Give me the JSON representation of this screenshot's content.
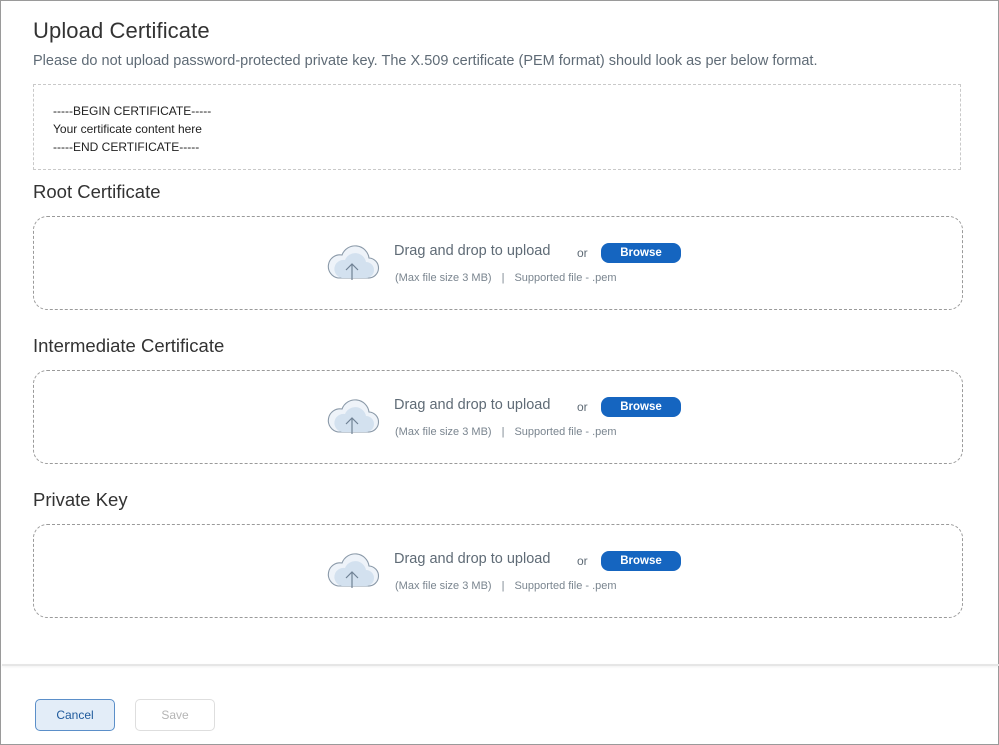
{
  "dialog": {
    "title": "Upload Certificate",
    "subtitle": "Please do not upload password-protected private key. The X.509 certificate (PEM format) should look as per below format."
  },
  "pem_example": {
    "line1": "-----BEGIN CERTIFICATE-----",
    "line2": "Your certificate content here",
    "line3": "-----END CERTIFICATE-----"
  },
  "sections": [
    {
      "label": "Root Certificate",
      "drop_text": "Drag and drop to upload",
      "or_text": "or",
      "browse_label": "Browse",
      "max_size": "(Max file size 3 MB)",
      "separator": "|",
      "supported": "Supported file -",
      "extension": ".pem"
    },
    {
      "label": "Intermediate Certificate",
      "drop_text": "Drag and drop to upload",
      "or_text": "or",
      "browse_label": "Browse",
      "max_size": "(Max file size 3 MB)",
      "separator": "|",
      "supported": "Supported file -",
      "extension": ".pem"
    },
    {
      "label": "Private Key",
      "drop_text": "Drag and drop to upload",
      "or_text": "or",
      "browse_label": "Browse",
      "max_size": "(Max file size 3 MB)",
      "separator": "|",
      "supported": "Supported file -",
      "extension": ".pem"
    }
  ],
  "footer": {
    "cancel_label": "Cancel",
    "save_label": "Save"
  },
  "icons": {
    "upload": "cloud-upload-icon"
  },
  "colors": {
    "accent": "#1565c0",
    "cancel_bg": "#e3edf8",
    "text_muted": "#5f6b76"
  }
}
